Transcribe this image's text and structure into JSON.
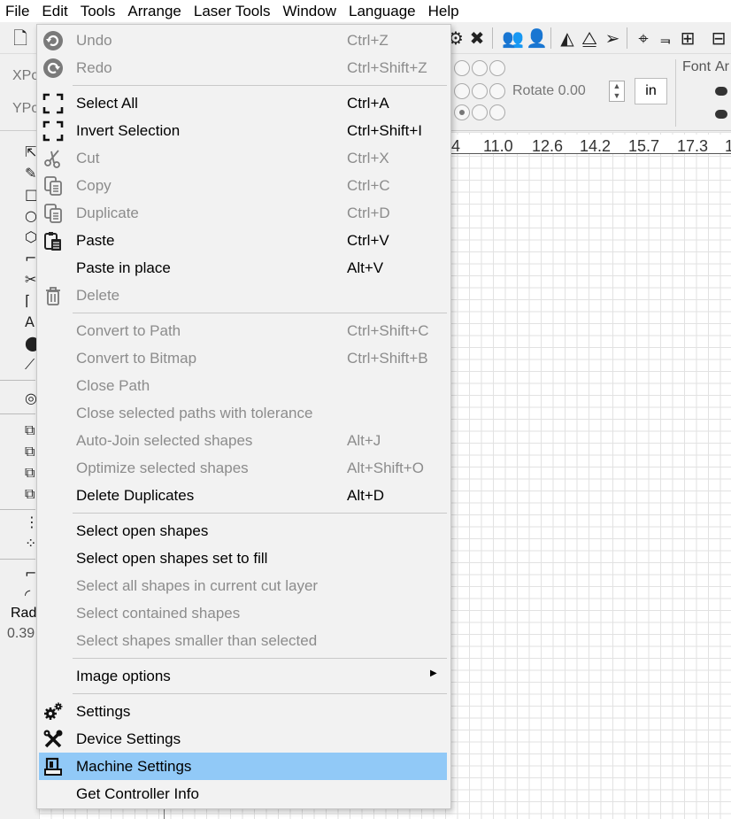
{
  "menubar": [
    "File",
    "Edit",
    "Tools",
    "Arrange",
    "Laser Tools",
    "Window",
    "Language",
    "Help"
  ],
  "position_panel": {
    "x_label": "XPo",
    "y_label": "YPo",
    "rotate_label": "Rotate",
    "rotate_value": "0.00",
    "unit": "in"
  },
  "font_panel": {
    "font_label": "Font",
    "align_label": "Ar"
  },
  "ruler": [
    "4",
    "11.0",
    "12.6",
    "14.2",
    "15.7",
    "17.3",
    "1"
  ],
  "shape_props": {
    "radius_label": "Rad",
    "radius_value": "0.39"
  },
  "edit_menu": {
    "items": [
      {
        "label": "Undo",
        "shortcut": "Ctrl+Z",
        "icon": "undo-icon",
        "enabled": false
      },
      {
        "label": "Redo",
        "shortcut": "Ctrl+Shift+Z",
        "icon": "redo-icon",
        "enabled": false
      },
      {
        "label": "Select All",
        "shortcut": "Ctrl+A",
        "icon": "select-all-icon",
        "enabled": true
      },
      {
        "label": "Invert Selection",
        "shortcut": "Ctrl+Shift+I",
        "icon": "invert-selection-icon",
        "enabled": true
      },
      {
        "label": "Cut",
        "shortcut": "Ctrl+X",
        "icon": "scissors-icon",
        "enabled": false
      },
      {
        "label": "Copy",
        "shortcut": "Ctrl+C",
        "icon": "copy-icon",
        "enabled": false
      },
      {
        "label": "Duplicate",
        "shortcut": "Ctrl+D",
        "icon": "duplicate-icon",
        "enabled": false
      },
      {
        "label": "Paste",
        "shortcut": "Ctrl+V",
        "icon": "paste-icon",
        "enabled": true
      },
      {
        "label": "Paste in place",
        "shortcut": "Alt+V",
        "icon": "",
        "enabled": true
      },
      {
        "label": "Delete",
        "shortcut": "",
        "icon": "trash-icon",
        "enabled": false
      },
      {
        "label": "Convert to Path",
        "shortcut": "Ctrl+Shift+C",
        "icon": "",
        "enabled": false
      },
      {
        "label": "Convert to Bitmap",
        "shortcut": "Ctrl+Shift+B",
        "icon": "",
        "enabled": false
      },
      {
        "label": "Close Path",
        "shortcut": "",
        "icon": "",
        "enabled": false
      },
      {
        "label": "Close selected paths with tolerance",
        "shortcut": "",
        "icon": "",
        "enabled": false
      },
      {
        "label": "Auto-Join selected shapes",
        "shortcut": "Alt+J",
        "icon": "",
        "enabled": false
      },
      {
        "label": "Optimize selected shapes",
        "shortcut": "Alt+Shift+O",
        "icon": "",
        "enabled": false
      },
      {
        "label": "Delete Duplicates",
        "shortcut": "Alt+D",
        "icon": "",
        "enabled": true
      },
      {
        "label": "Select open shapes",
        "shortcut": "",
        "icon": "",
        "enabled": true
      },
      {
        "label": "Select open shapes set to fill",
        "shortcut": "",
        "icon": "",
        "enabled": true
      },
      {
        "label": "Select all shapes in current cut layer",
        "shortcut": "",
        "icon": "",
        "enabled": false
      },
      {
        "label": "Select contained shapes",
        "shortcut": "",
        "icon": "",
        "enabled": false
      },
      {
        "label": "Select shapes smaller than selected",
        "shortcut": "",
        "icon": "",
        "enabled": false
      },
      {
        "label": "Image options",
        "shortcut": "",
        "icon": "",
        "enabled": true,
        "submenu": true
      },
      {
        "label": "Settings",
        "shortcut": "",
        "icon": "gears-icon",
        "enabled": true
      },
      {
        "label": "Device Settings",
        "shortcut": "",
        "icon": "tools-icon",
        "enabled": true
      },
      {
        "label": "Machine Settings",
        "shortcut": "",
        "icon": "machine-icon",
        "enabled": true,
        "highlighted": true
      },
      {
        "label": "Get Controller Info",
        "shortcut": "",
        "icon": "",
        "enabled": true
      }
    ]
  }
}
